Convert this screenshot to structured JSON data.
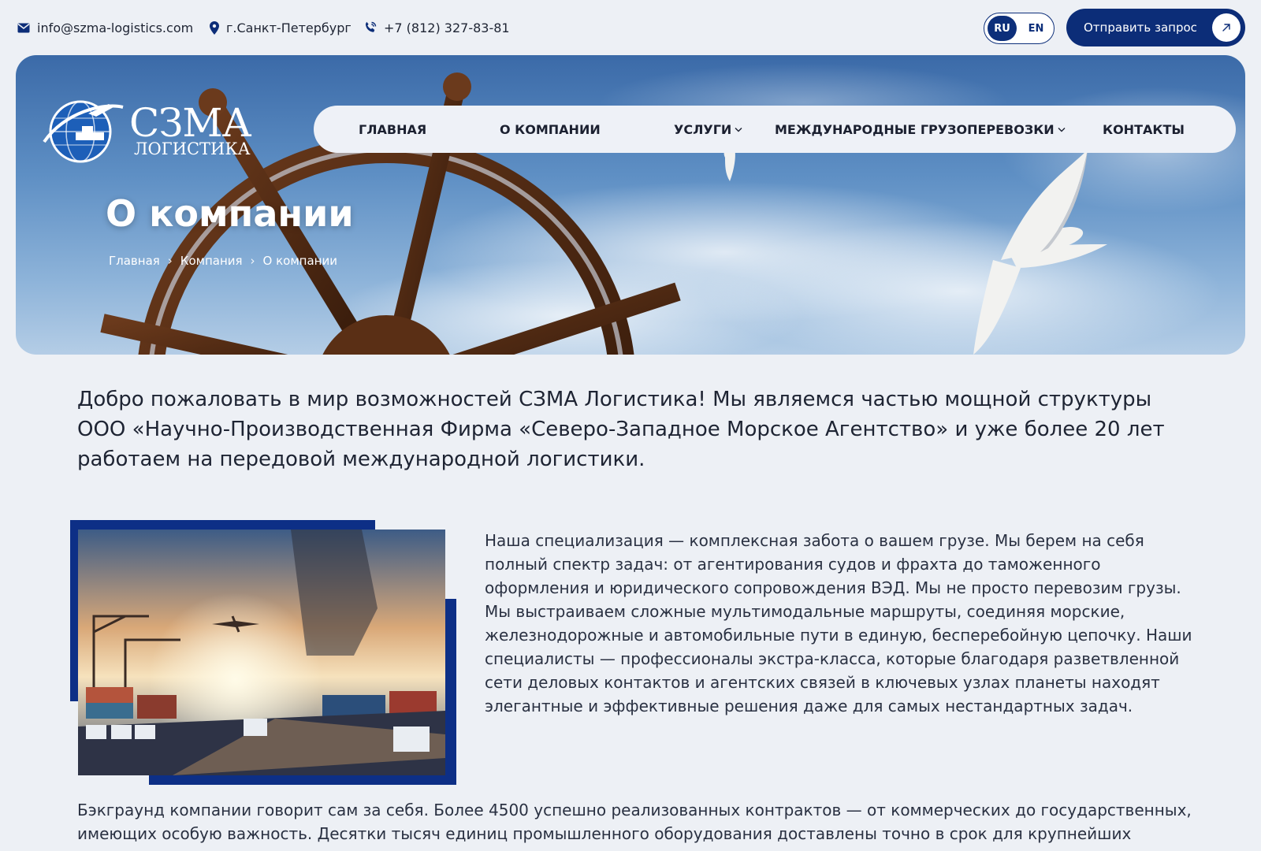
{
  "topbar": {
    "email": "info@szma-logistics.com",
    "city": "г.Санкт-Петербург",
    "phone": "+7 (812) 327-83-81",
    "lang_ru": "RU",
    "lang_en": "EN",
    "lang_active": "RU",
    "cta_label": "Отправить запрос"
  },
  "logo": {
    "main": "СЗМА",
    "sub": "ЛОГИСТИКА"
  },
  "nav": {
    "home": "ГЛАВНАЯ",
    "about": "О КОМПАНИИ",
    "services": "УСЛУГИ",
    "international": "МЕЖДУНАРОДНЫЕ ГРУЗОПЕРЕВОЗКИ",
    "contacts": "КОНТАКТЫ"
  },
  "hero": {
    "title": "О компании",
    "breadcrumb": [
      "Главная",
      "Компания",
      "О компании"
    ],
    "breadcrumb_sep": "›"
  },
  "content": {
    "intro": "Добро пожаловать в мир возможностей СЗМА Логистика! Мы являемся частью мощной структуры ООО «Научно-Производственная Фирма «Северо-Западное Морское Агентство» и уже более 20 лет работаем на передовой международной логистики.",
    "specialization": "Наша специализация — комплексная забота о вашем грузе. Мы берем на себя полный спектр задач: от агентирования судов и фрахта до таможенного оформления и юридического сопровождения ВЭД. Мы не просто перевозим грузы. Мы выстраиваем сложные мультимодальные маршруты, соединяя морские, железнодорожные и автомобильные пути в единую, бесперебойную цепочку. Наши специалисты — профессионалы экстра-класса, которые благодаря разветвленной сети деловых контактов и агентских связей в ключевых узлах планеты находят элегантные и эффективные решения даже для самых нестандартных задач.",
    "background": "Бэкграунд компании говорит сам за себя. Более 4500 успешно реализованных контрактов — от коммерческих до государственных, имеющих особую важность. Десятки тысяч единиц промышленного оборудования доставлены точно в срок для крупнейших"
  },
  "icons": {
    "email": "envelope-icon",
    "city": "map-pin-icon",
    "phone": "phone-icon",
    "cta": "arrow-up-right-icon",
    "dropdown": "chevron-down-icon"
  },
  "colors": {
    "brand": "#0c2d78",
    "page_bg": "#edf0f5",
    "nav_bg": "#eef1f7"
  }
}
